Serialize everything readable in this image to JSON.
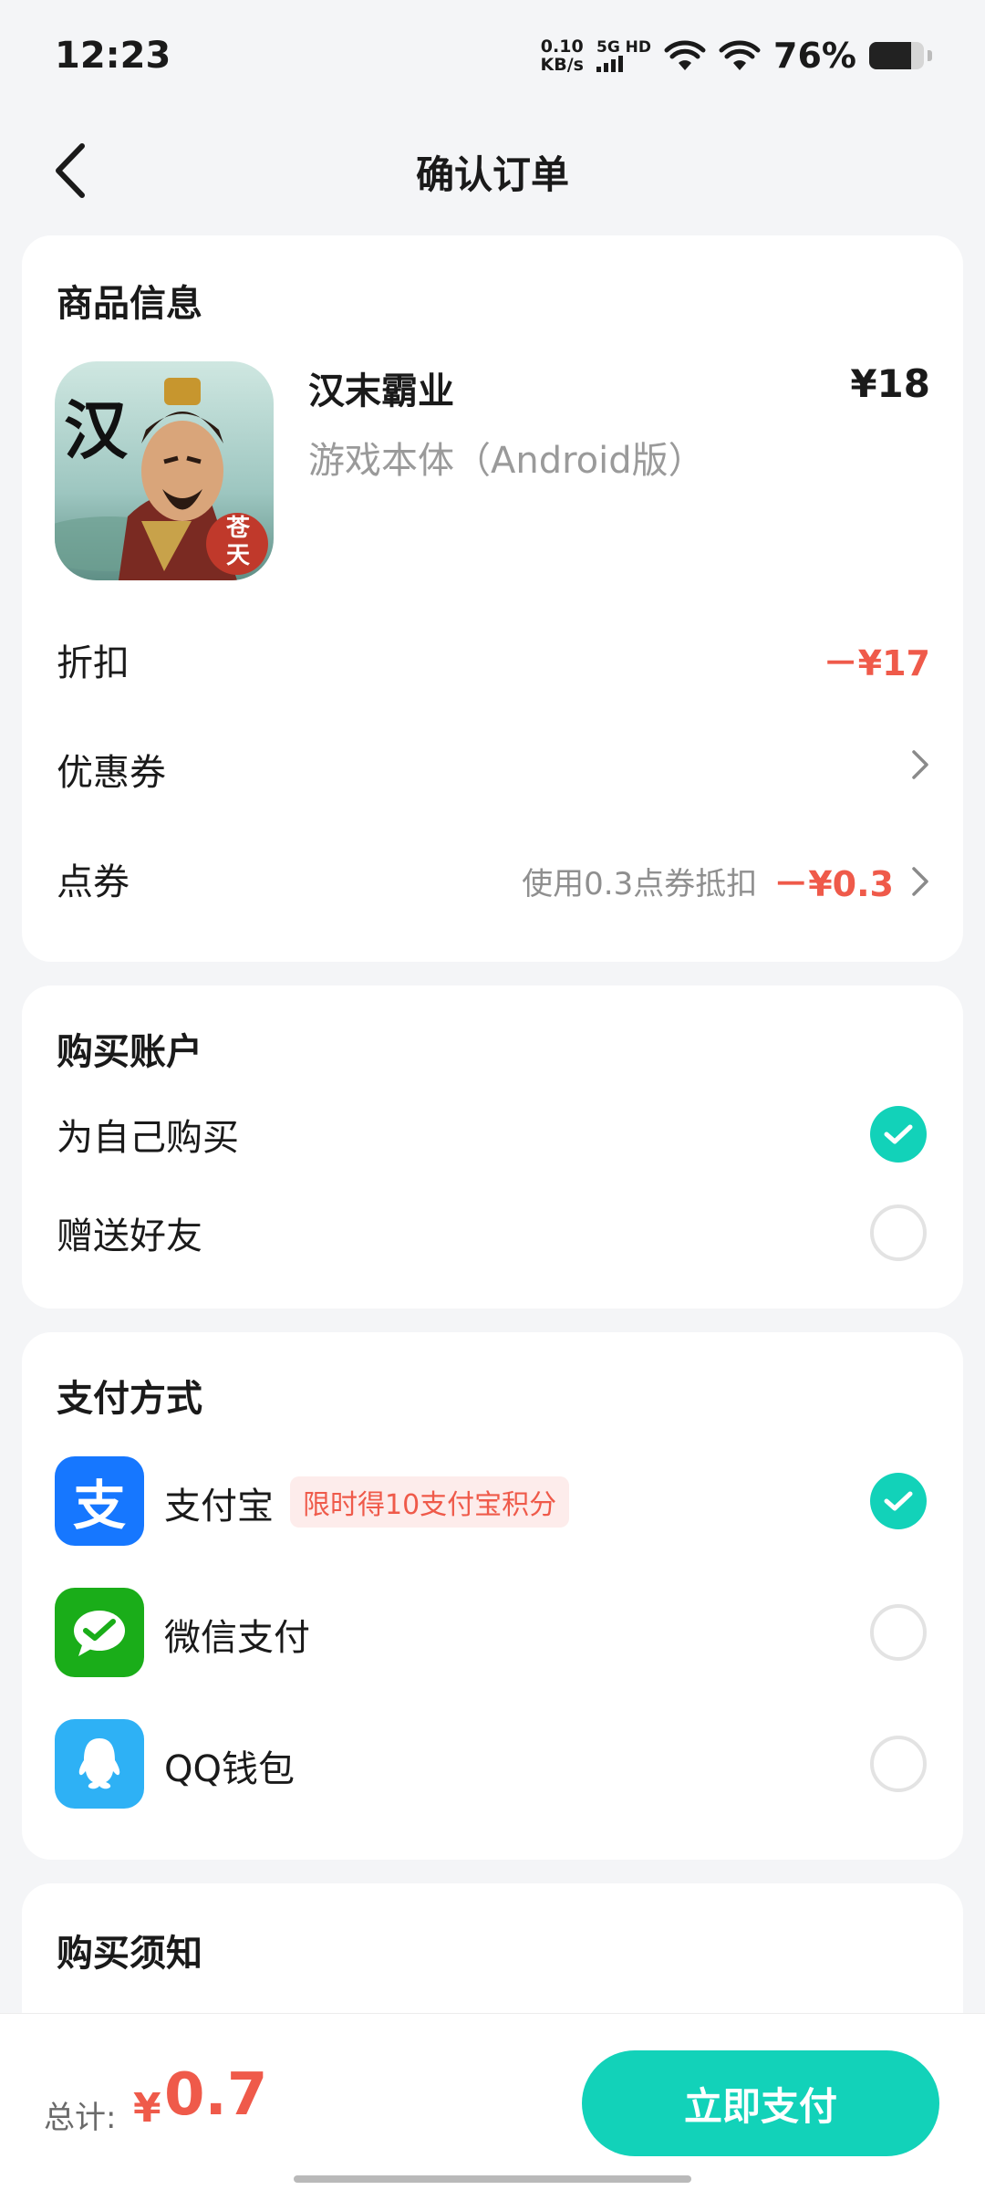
{
  "status": {
    "time": "12:23",
    "net_speed_value": "0.10",
    "net_speed_unit": "KB/s",
    "network": "5G HD",
    "battery_pct": "76%",
    "battery_level": 0.76
  },
  "header": {
    "title": "确认订单"
  },
  "product": {
    "section_title": "商品信息",
    "name": "汉末霸业",
    "subtitle": "游戏本体（Android版）",
    "price": "¥18",
    "icon_chars": {
      "main": "汉",
      "seal": "苍天"
    },
    "discount_label": "折扣",
    "discount_value": "－¥17",
    "coupon_label": "优惠券",
    "points_label": "点券",
    "points_note": "使用0.3点券抵扣",
    "points_value": "－¥0.3"
  },
  "account": {
    "section_title": "购买账户",
    "options": [
      {
        "label": "为自己购买",
        "selected": true
      },
      {
        "label": "赠送好友",
        "selected": false
      }
    ]
  },
  "payment": {
    "section_title": "支付方式",
    "methods": [
      {
        "label": "支付宝",
        "badge": "限时得10支付宝积分",
        "icon": "alipay-icon",
        "icon_char": "支",
        "color": "#1677ff",
        "selected": true
      },
      {
        "label": "微信支付",
        "icon": "wechat-pay-icon",
        "color": "#1aad19",
        "selected": false
      },
      {
        "label": "QQ钱包",
        "icon": "qq-wallet-icon",
        "color": "#2eb1f5",
        "selected": false
      }
    ]
  },
  "notice": {
    "section_title": "购买须知"
  },
  "footer": {
    "total_label": "总计:",
    "currency": "¥",
    "total_value": "0.7",
    "pay_button": "立即支付"
  },
  "colors": {
    "accent": "#12d2b9",
    "price_red": "#ef5a4a"
  }
}
